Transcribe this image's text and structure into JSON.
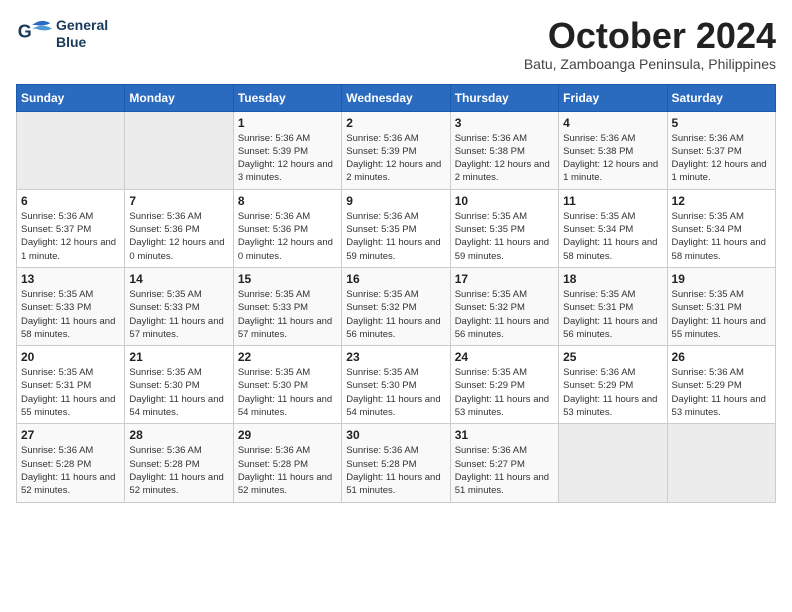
{
  "logo": {
    "line1": "General",
    "line2": "Blue"
  },
  "title": "October 2024",
  "subtitle": "Batu, Zamboanga Peninsula, Philippines",
  "weekdays": [
    "Sunday",
    "Monday",
    "Tuesday",
    "Wednesday",
    "Thursday",
    "Friday",
    "Saturday"
  ],
  "weeks": [
    [
      {
        "day": "",
        "sunrise": "",
        "sunset": "",
        "daylight": ""
      },
      {
        "day": "",
        "sunrise": "",
        "sunset": "",
        "daylight": ""
      },
      {
        "day": "1",
        "sunrise": "Sunrise: 5:36 AM",
        "sunset": "Sunset: 5:39 PM",
        "daylight": "Daylight: 12 hours and 3 minutes."
      },
      {
        "day": "2",
        "sunrise": "Sunrise: 5:36 AM",
        "sunset": "Sunset: 5:39 PM",
        "daylight": "Daylight: 12 hours and 2 minutes."
      },
      {
        "day": "3",
        "sunrise": "Sunrise: 5:36 AM",
        "sunset": "Sunset: 5:38 PM",
        "daylight": "Daylight: 12 hours and 2 minutes."
      },
      {
        "day": "4",
        "sunrise": "Sunrise: 5:36 AM",
        "sunset": "Sunset: 5:38 PM",
        "daylight": "Daylight: 12 hours and 1 minute."
      },
      {
        "day": "5",
        "sunrise": "Sunrise: 5:36 AM",
        "sunset": "Sunset: 5:37 PM",
        "daylight": "Daylight: 12 hours and 1 minute."
      }
    ],
    [
      {
        "day": "6",
        "sunrise": "Sunrise: 5:36 AM",
        "sunset": "Sunset: 5:37 PM",
        "daylight": "Daylight: 12 hours and 1 minute."
      },
      {
        "day": "7",
        "sunrise": "Sunrise: 5:36 AM",
        "sunset": "Sunset: 5:36 PM",
        "daylight": "Daylight: 12 hours and 0 minutes."
      },
      {
        "day": "8",
        "sunrise": "Sunrise: 5:36 AM",
        "sunset": "Sunset: 5:36 PM",
        "daylight": "Daylight: 12 hours and 0 minutes."
      },
      {
        "day": "9",
        "sunrise": "Sunrise: 5:36 AM",
        "sunset": "Sunset: 5:35 PM",
        "daylight": "Daylight: 11 hours and 59 minutes."
      },
      {
        "day": "10",
        "sunrise": "Sunrise: 5:35 AM",
        "sunset": "Sunset: 5:35 PM",
        "daylight": "Daylight: 11 hours and 59 minutes."
      },
      {
        "day": "11",
        "sunrise": "Sunrise: 5:35 AM",
        "sunset": "Sunset: 5:34 PM",
        "daylight": "Daylight: 11 hours and 58 minutes."
      },
      {
        "day": "12",
        "sunrise": "Sunrise: 5:35 AM",
        "sunset": "Sunset: 5:34 PM",
        "daylight": "Daylight: 11 hours and 58 minutes."
      }
    ],
    [
      {
        "day": "13",
        "sunrise": "Sunrise: 5:35 AM",
        "sunset": "Sunset: 5:33 PM",
        "daylight": "Daylight: 11 hours and 58 minutes."
      },
      {
        "day": "14",
        "sunrise": "Sunrise: 5:35 AM",
        "sunset": "Sunset: 5:33 PM",
        "daylight": "Daylight: 11 hours and 57 minutes."
      },
      {
        "day": "15",
        "sunrise": "Sunrise: 5:35 AM",
        "sunset": "Sunset: 5:33 PM",
        "daylight": "Daylight: 11 hours and 57 minutes."
      },
      {
        "day": "16",
        "sunrise": "Sunrise: 5:35 AM",
        "sunset": "Sunset: 5:32 PM",
        "daylight": "Daylight: 11 hours and 56 minutes."
      },
      {
        "day": "17",
        "sunrise": "Sunrise: 5:35 AM",
        "sunset": "Sunset: 5:32 PM",
        "daylight": "Daylight: 11 hours and 56 minutes."
      },
      {
        "day": "18",
        "sunrise": "Sunrise: 5:35 AM",
        "sunset": "Sunset: 5:31 PM",
        "daylight": "Daylight: 11 hours and 56 minutes."
      },
      {
        "day": "19",
        "sunrise": "Sunrise: 5:35 AM",
        "sunset": "Sunset: 5:31 PM",
        "daylight": "Daylight: 11 hours and 55 minutes."
      }
    ],
    [
      {
        "day": "20",
        "sunrise": "Sunrise: 5:35 AM",
        "sunset": "Sunset: 5:31 PM",
        "daylight": "Daylight: 11 hours and 55 minutes."
      },
      {
        "day": "21",
        "sunrise": "Sunrise: 5:35 AM",
        "sunset": "Sunset: 5:30 PM",
        "daylight": "Daylight: 11 hours and 54 minutes."
      },
      {
        "day": "22",
        "sunrise": "Sunrise: 5:35 AM",
        "sunset": "Sunset: 5:30 PM",
        "daylight": "Daylight: 11 hours and 54 minutes."
      },
      {
        "day": "23",
        "sunrise": "Sunrise: 5:35 AM",
        "sunset": "Sunset: 5:30 PM",
        "daylight": "Daylight: 11 hours and 54 minutes."
      },
      {
        "day": "24",
        "sunrise": "Sunrise: 5:35 AM",
        "sunset": "Sunset: 5:29 PM",
        "daylight": "Daylight: 11 hours and 53 minutes."
      },
      {
        "day": "25",
        "sunrise": "Sunrise: 5:36 AM",
        "sunset": "Sunset: 5:29 PM",
        "daylight": "Daylight: 11 hours and 53 minutes."
      },
      {
        "day": "26",
        "sunrise": "Sunrise: 5:36 AM",
        "sunset": "Sunset: 5:29 PM",
        "daylight": "Daylight: 11 hours and 53 minutes."
      }
    ],
    [
      {
        "day": "27",
        "sunrise": "Sunrise: 5:36 AM",
        "sunset": "Sunset: 5:28 PM",
        "daylight": "Daylight: 11 hours and 52 minutes."
      },
      {
        "day": "28",
        "sunrise": "Sunrise: 5:36 AM",
        "sunset": "Sunset: 5:28 PM",
        "daylight": "Daylight: 11 hours and 52 minutes."
      },
      {
        "day": "29",
        "sunrise": "Sunrise: 5:36 AM",
        "sunset": "Sunset: 5:28 PM",
        "daylight": "Daylight: 11 hours and 52 minutes."
      },
      {
        "day": "30",
        "sunrise": "Sunrise: 5:36 AM",
        "sunset": "Sunset: 5:28 PM",
        "daylight": "Daylight: 11 hours and 51 minutes."
      },
      {
        "day": "31",
        "sunrise": "Sunrise: 5:36 AM",
        "sunset": "Sunset: 5:27 PM",
        "daylight": "Daylight: 11 hours and 51 minutes."
      },
      {
        "day": "",
        "sunrise": "",
        "sunset": "",
        "daylight": ""
      },
      {
        "day": "",
        "sunrise": "",
        "sunset": "",
        "daylight": ""
      }
    ]
  ]
}
